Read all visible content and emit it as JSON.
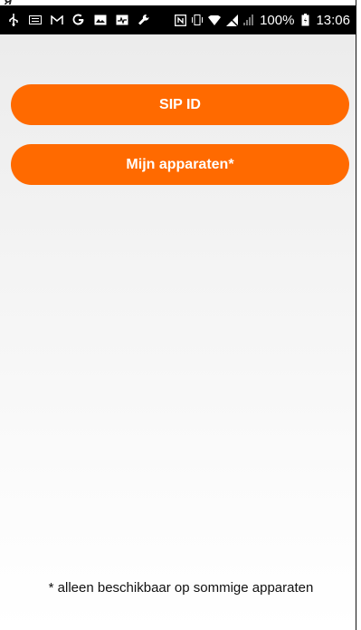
{
  "status_bar": {
    "battery_percent": "100%",
    "time": "13:06",
    "left_icons": [
      "usb-icon",
      "keyboard-icon",
      "gmail-icon",
      "google-icon",
      "image-icon",
      "pulse-icon",
      "wrench-icon"
    ],
    "right_icons": [
      "nfc-icon",
      "vibrate-icon",
      "wifi-icon",
      "no-sim-icon",
      "signal-icon",
      "battery-icon"
    ]
  },
  "buttons": {
    "sip_id": "SIP ID",
    "my_devices": "Mijn apparaten*"
  },
  "footnote": "* alleen beschikbaar op sommige apparaten",
  "colors": {
    "accent": "#ff6a00",
    "status_bar_bg": "#000000",
    "button_text": "#ffffff"
  }
}
